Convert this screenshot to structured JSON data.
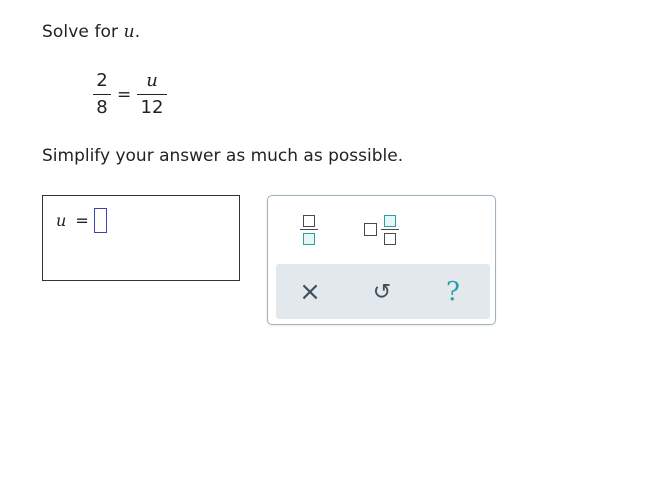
{
  "problem": {
    "prompt_text": "Solve for ",
    "prompt_var": "u",
    "prompt_end": ".",
    "equation": {
      "left": {
        "numerator": "2",
        "denominator": "8"
      },
      "operator": "=",
      "right": {
        "numerator": "u",
        "denominator": "12"
      }
    },
    "instruction": "Simplify your answer as much as possible."
  },
  "answer": {
    "label_var": "u",
    "label_eq": "=",
    "value": ""
  },
  "palette": {
    "tools": [
      {
        "name": "fraction",
        "icon": "fraction-icon"
      },
      {
        "name": "mixed-number",
        "icon": "mixed-number-icon"
      }
    ],
    "actions": [
      {
        "name": "clear",
        "symbol": "×",
        "icon": "close-icon"
      },
      {
        "name": "undo",
        "symbol": "↺",
        "icon": "undo-icon"
      },
      {
        "name": "help",
        "symbol": "?",
        "icon": "help-icon"
      }
    ],
    "colors": {
      "accent": "#2a9fa8",
      "input_border": "#3b45b8",
      "palette_bg": "#e3e8ec"
    }
  }
}
